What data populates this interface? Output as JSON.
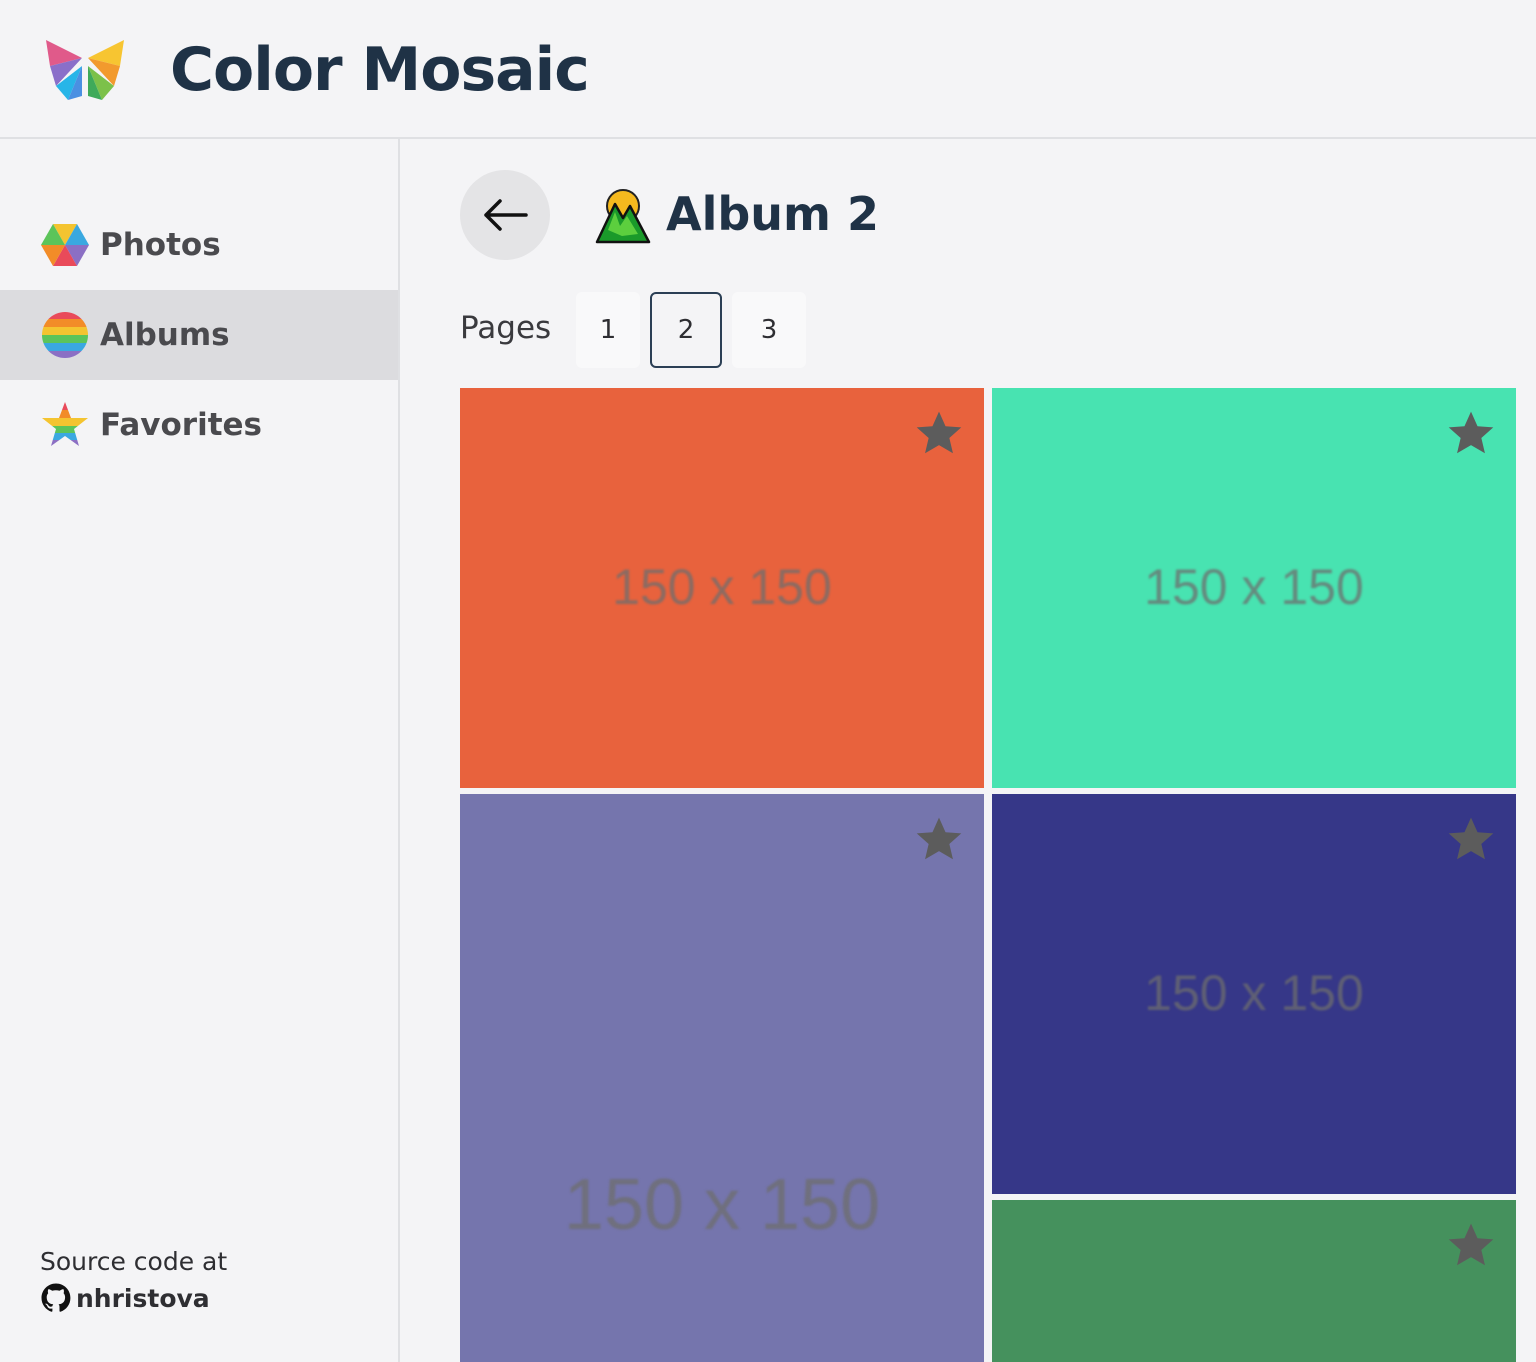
{
  "app": {
    "title": "Color Mosaic"
  },
  "sidebar": {
    "items": [
      {
        "label": "Photos",
        "icon": "hexagon-photos-icon",
        "active": false
      },
      {
        "label": "Albums",
        "icon": "rainbow-ball-icon",
        "active": true
      },
      {
        "label": "Favorites",
        "icon": "rainbow-star-icon",
        "active": false
      }
    ],
    "source_text": "Source code at",
    "github_user": "nhristova"
  },
  "album": {
    "title": "Album 2",
    "icon": "sunrise-mountain-icon"
  },
  "pagination": {
    "label": "Pages",
    "pages": [
      "1",
      "2",
      "3"
    ],
    "current": "2"
  },
  "photos": [
    {
      "label": "150 x 150",
      "color": "#e8623d",
      "favorite": false
    },
    {
      "label": "150 x 150",
      "color": "#48e3b1",
      "favorite": false
    },
    {
      "label": "150 x 150",
      "color": "#7575ad",
      "favorite": false
    },
    {
      "label": "150 x 150",
      "color": "#363788",
      "favorite": false
    },
    {
      "label": "",
      "color": "#45915d",
      "favorite": false
    }
  ]
}
